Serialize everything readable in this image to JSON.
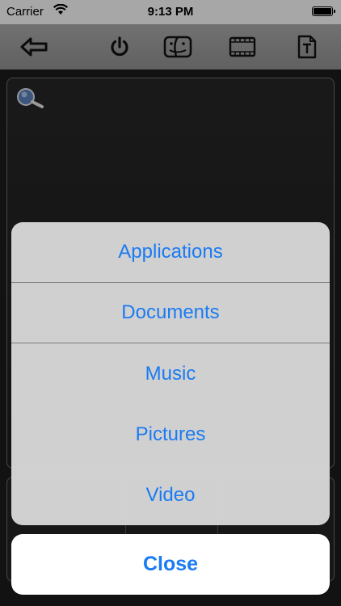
{
  "status_bar": {
    "carrier": "Carrier",
    "time": "9:13 PM",
    "battery_level": 1.0,
    "wifi_icon": "wifi-icon"
  },
  "toolbar": {
    "icons": [
      "back-arrow-icon",
      "power-icon",
      "finder-icon",
      "film-icon",
      "text-icon"
    ]
  },
  "pad": {
    "search_icon": "search-icon"
  },
  "action_sheet": {
    "items": [
      {
        "label": "Applications"
      },
      {
        "label": "Documents"
      },
      {
        "label": "Music"
      },
      {
        "label": "Pictures"
      },
      {
        "label": "Video"
      }
    ],
    "close_label": "Close"
  },
  "colors": {
    "accent": "#1a7bf3",
    "toolbar": "#9b9b9b",
    "sheet_bg": "#d7d7d7"
  }
}
